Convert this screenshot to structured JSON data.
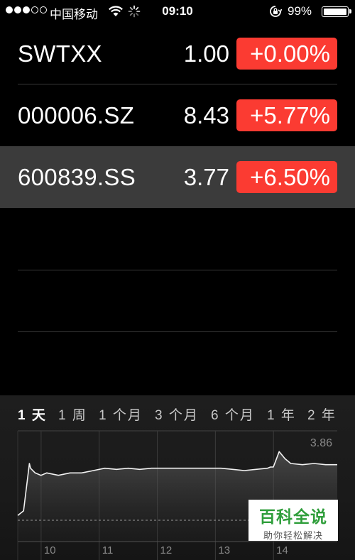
{
  "status_bar": {
    "carrier": "中国移动",
    "time": "09:10",
    "battery": "99%",
    "signal_bars_filled": 3,
    "signal_bars_total": 5
  },
  "stocks": [
    {
      "symbol": "SWTXX",
      "price": "1.00",
      "change": "+0.00%",
      "selected": false
    },
    {
      "symbol": "000006.SZ",
      "price": "8.43",
      "change": "+5.77%",
      "selected": false
    },
    {
      "symbol": "600839.SS",
      "price": "3.77",
      "change": "+6.50%",
      "selected": true
    }
  ],
  "colors": {
    "change_badge": "#fb3b32",
    "selected_row": "#3b3b3b",
    "watermark_green": "#2f9e3b"
  },
  "ranges": [
    {
      "label": "1 天",
      "active": true
    },
    {
      "label": "1 周",
      "active": false
    },
    {
      "label": "1 个月",
      "active": false
    },
    {
      "label": "3 个月",
      "active": false
    },
    {
      "label": "6 个月",
      "active": false
    },
    {
      "label": "1 年",
      "active": false
    },
    {
      "label": "2 年",
      "active": false
    }
  ],
  "chart_data": {
    "type": "line",
    "title": "",
    "xlabel": "",
    "ylabel": "",
    "x_ticks": [
      "10",
      "11",
      "12",
      "13",
      "14"
    ],
    "max_label": "3.86",
    "x": [
      9.5,
      9.6,
      9.7,
      9.72,
      9.8,
      9.9,
      10.0,
      10.2,
      10.4,
      10.6,
      10.8,
      11.0,
      11.2,
      11.4,
      11.6,
      11.8,
      12.0,
      12.5,
      13.0,
      13.2,
      13.4,
      13.6,
      13.8,
      13.85,
      13.9,
      14.0,
      14.1,
      14.2,
      14.4,
      14.6,
      14.8,
      15.0
    ],
    "values": [
      3.56,
      3.58,
      3.78,
      3.76,
      3.74,
      3.73,
      3.74,
      3.73,
      3.74,
      3.74,
      3.75,
      3.76,
      3.755,
      3.76,
      3.755,
      3.76,
      3.76,
      3.76,
      3.76,
      3.755,
      3.75,
      3.755,
      3.76,
      3.765,
      3.765,
      3.83,
      3.8,
      3.78,
      3.775,
      3.78,
      3.775,
      3.775
    ],
    "reference_line": 3.54,
    "ylim": [
      3.45,
      3.9
    ],
    "xlim": [
      9.5,
      15.0
    ],
    "grid": true
  },
  "watermark": {
    "title": "百科全说",
    "subtitle": "助你轻松解决"
  }
}
